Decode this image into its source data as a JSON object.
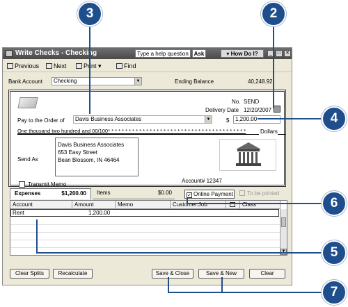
{
  "callouts": [
    "3",
    "2",
    "4",
    "6",
    "5",
    "7"
  ],
  "window": {
    "title": "Write Checks - Checking",
    "help_placeholder": "Type a help question",
    "ask_label": "Ask",
    "howdoi_label": "How Do I?"
  },
  "toolbar": {
    "previous": "Previous",
    "next": "Next",
    "print": "Print",
    "find": "Find"
  },
  "bank": {
    "label": "Bank Account",
    "value": "Checking",
    "ending_label": "Ending Balance",
    "ending_value": "40,248.92"
  },
  "check": {
    "no_label": "No.",
    "no_value": "SEND",
    "date_label": "Delivery Date",
    "date_value": "12/20/2007",
    "payto_label": "Pay to the Order of",
    "payee": "Davis Business Associates",
    "currency": "$",
    "amount": "1,200.00",
    "amount_words": "One thousand two hundred and 00/100* * * * * * * * * * * * * * * * * * * * * * * * * * * * * * * * * * * * * * * *",
    "dollars_label": "Dollars",
    "sendas_label": "Send As",
    "address": [
      "Davis Business Associates",
      "653 Easy Street",
      "Bean Blossom, IN 46464"
    ],
    "account": "Account# 12347",
    "transmit_label": "Transmit Memo"
  },
  "tabs": {
    "expenses_label": "Expenses",
    "expenses_value": "$1,200.00",
    "items_label": "Items",
    "items_value": "$0.00",
    "online_payment": "Online Payment",
    "to_be_printed": "To be printed"
  },
  "grid": {
    "columns": [
      "Account",
      "Amount",
      "Memo",
      "Customer:Job",
      "",
      "Class"
    ],
    "rows": [
      {
        "account": "Rent",
        "amount": "1,200.00"
      }
    ]
  },
  "buttons": {
    "clear_splits": "Clear Splits",
    "recalculate": "Recalculate",
    "save_close": "Save & Close",
    "save_new": "Save & New",
    "clear": "Clear"
  },
  "colors": {
    "callout": "#1f4e8c",
    "window_bg": "#ece9d8"
  }
}
